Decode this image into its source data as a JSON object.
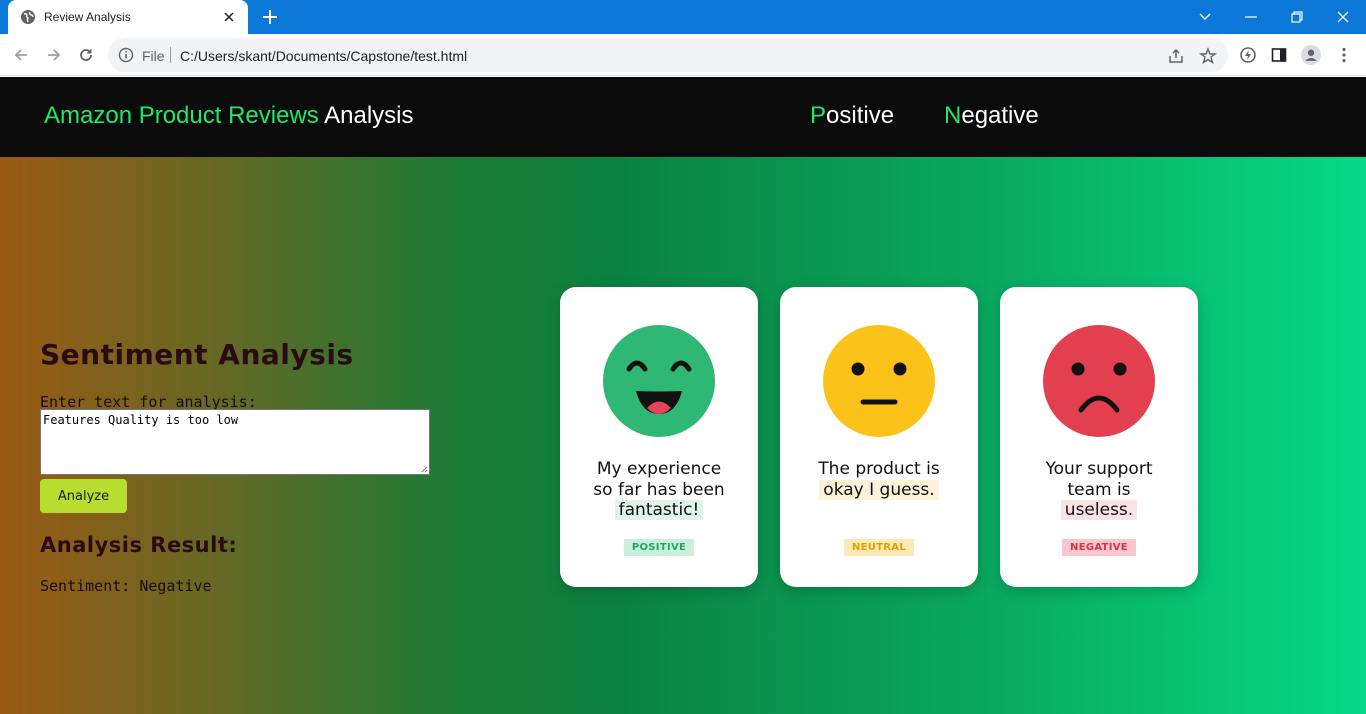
{
  "browser": {
    "tab_title": "Review Analysis",
    "file_label": "File",
    "url": "C:/Users/skant/Documents/Capstone/test.html"
  },
  "header": {
    "brand_green": "Amazon Product Reviews",
    "brand_white": "Analysis",
    "nav": [
      {
        "first": "P",
        "rest": "ositive"
      },
      {
        "first": "N",
        "rest": "egative"
      }
    ]
  },
  "form": {
    "title": "Sentiment Analysis",
    "input_label": "Enter text for analysis:",
    "input_value": "Features Quality is too low",
    "button_label": "Analyze",
    "result_title": "Analysis Result:",
    "result_text": "Sentiment: Negative"
  },
  "cards": [
    {
      "line1": "My experience",
      "line2": "so far has been",
      "highlight": "fantastic!",
      "badge": "POSITIVE",
      "face_color": "#2fb774",
      "hl_color": "#dff5ea",
      "badge_bg": "#c9f0db",
      "badge_fg": "#21a862"
    },
    {
      "line1": "The product is",
      "line2": "",
      "highlight": "okay I guess.",
      "badge": "NEUTRAL",
      "face_color": "#fbc21a",
      "hl_color": "#fdf3da",
      "badge_bg": "#fde9b5",
      "badge_fg": "#e0a200"
    },
    {
      "line1": "Your support",
      "line2": "team is",
      "highlight": "useless.",
      "badge": "NEGATIVE",
      "face_color": "#e2404f",
      "hl_color": "#fbe2e4",
      "badge_bg": "#f8c7cd",
      "badge_fg": "#d63447"
    }
  ]
}
